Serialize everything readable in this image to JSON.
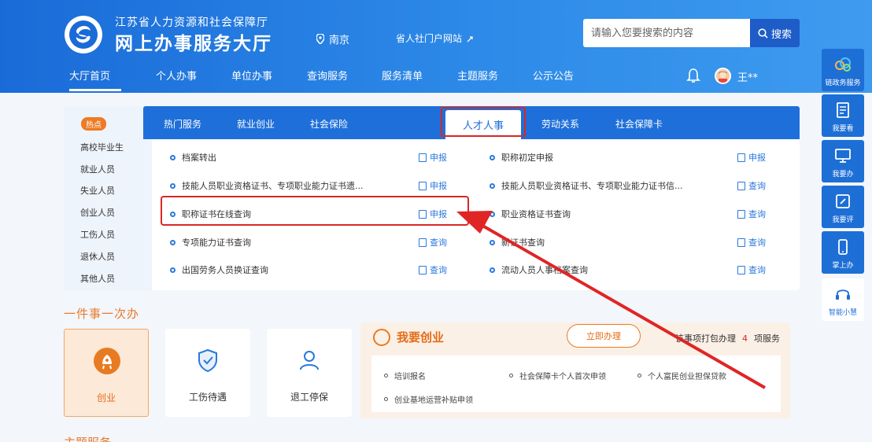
{
  "header": {
    "org_sub": "江苏省人力资源和社会保障厅",
    "org_main": "网上办事服务大厅",
    "location": "南京",
    "portal_link": "省人社门户网站",
    "search_placeholder": "请输入您要搜索的内容",
    "search_button": "搜索",
    "user_name": "王**"
  },
  "main_nav": [
    "大厅首页",
    "个人办事",
    "单位办事",
    "查询服务",
    "服务清单",
    "主题服务",
    "公示公告"
  ],
  "right_sidebar": [
    "链政务服务",
    "我要看",
    "我要办",
    "我要评",
    "掌上办",
    "智能小慧"
  ],
  "panel": {
    "tag": "热点",
    "left_categories": [
      "高校毕业生",
      "就业人员",
      "失业人员",
      "创业人员",
      "工伤人员",
      "退休人员",
      "其他人员"
    ],
    "tabs": [
      "热门服务",
      "就业创业",
      "社会保险",
      "人才人事",
      "劳动关系",
      "社会保障卡"
    ],
    "active_tab": "人才人事",
    "services_left": [
      {
        "name": "档案转出",
        "action": "申报"
      },
      {
        "name": "技能人员职业资格证书、专项职业能力证书遗...",
        "action": "申报"
      },
      {
        "name": "职称证书在线查询",
        "action": "申报"
      },
      {
        "name": "专项能力证书查询",
        "action": "查询"
      },
      {
        "name": "出国劳务人员换证查询",
        "action": "查询"
      }
    ],
    "services_right": [
      {
        "name": "职称初定申报",
        "action": "申报"
      },
      {
        "name": "技能人员职业资格证书、专项职业能力证书信...",
        "action": "查询"
      },
      {
        "name": "职业资格证书查询",
        "action": "查询"
      },
      {
        "name": "新证书查询",
        "action": "查询"
      },
      {
        "name": "流动人员人事档案查询",
        "action": "查询"
      }
    ]
  },
  "one_thing": {
    "title": "一件事一次办",
    "cards": [
      "创业",
      "工伤待遇",
      "退工停保"
    ],
    "active_card": "创业",
    "biz": {
      "title": "我要创业",
      "button": "立即办理",
      "pack_prefix": "该事项打包办理",
      "pack_count": "4",
      "pack_suffix": "项服务",
      "items": [
        "培训报名",
        "社会保障卡个人首次申领",
        "个人富民创业担保贷款",
        "创业基地运营补贴申领"
      ]
    }
  },
  "section2_title": "主题服务",
  "colors": {
    "primary_blue": "#1e6fd9",
    "accent_orange": "#e87b21",
    "highlight_red": "#d82727"
  }
}
